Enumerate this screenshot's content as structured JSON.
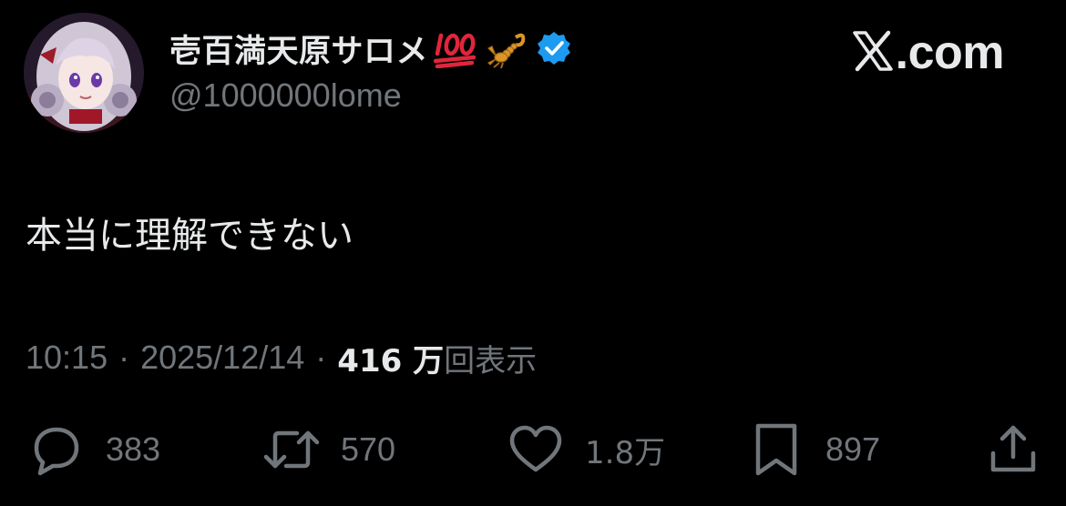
{
  "author": {
    "display_name": "壱百満天原サロメ",
    "name_emojis": [
      "hundred-points-emoji",
      "scorpion-emoji"
    ],
    "verified": true,
    "handle": "@1000000lome"
  },
  "brand": {
    "text": ".com"
  },
  "tweet": {
    "text": "本当に理解できない"
  },
  "meta": {
    "time": "10:15",
    "separator": "·",
    "date": "2025/12/14",
    "views_count": "416 万",
    "views_label": "回表示"
  },
  "actions": {
    "replies": "383",
    "reposts": "570",
    "likes": "1.8万",
    "bookmarks": "897"
  },
  "colors": {
    "background": "#000000",
    "primary_text": "#e7e9ea",
    "secondary_text": "#71767b",
    "verified_badge": "#1d9bf0"
  }
}
